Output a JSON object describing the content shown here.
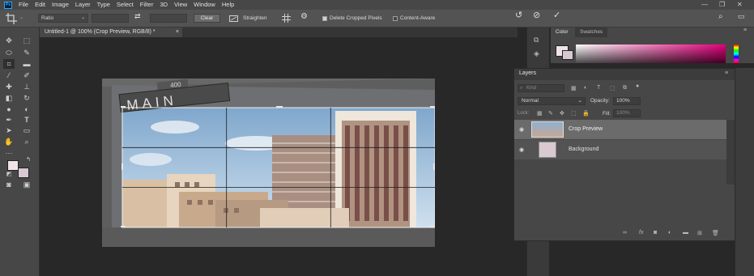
{
  "menubar": {
    "items": [
      "File",
      "Edit",
      "Image",
      "Layer",
      "Type",
      "Select",
      "Filter",
      "3D",
      "View",
      "Window",
      "Help"
    ],
    "logo": "Ps"
  },
  "options": {
    "ratio": "Ratio",
    "clear": "Clear",
    "straighten": "Straighten",
    "delete_cropped": "Delete Cropped Pixels",
    "content_aware": "Content-Aware"
  },
  "document": {
    "tab_title": "Untitled-1 @ 100% (Crop Preview, RGB/8) *",
    "tab_close": "×"
  },
  "color_panel": {
    "tabs": [
      "Color",
      "Swatches"
    ]
  },
  "layers_panel": {
    "title": "Layers",
    "filter_placeholder": "Kind",
    "blend_mode": "Normal",
    "opacity_label": "Opacity:",
    "opacity_value": "100%",
    "lock_label": "Lock:",
    "fill_label": "Fill:",
    "fill_value": "100%",
    "layers": [
      {
        "name": "Crop Preview",
        "selected": true
      },
      {
        "name": "Background",
        "selected": false
      }
    ]
  },
  "image": {
    "sign_number": "400",
    "sign_text": "MAIN"
  },
  "colors": {
    "accent": "#31a8ff",
    "panel": "#474747",
    "canvas": "#282828",
    "foreground_swatch": "#efe3e8",
    "background_swatch": "#d8c8d2"
  }
}
